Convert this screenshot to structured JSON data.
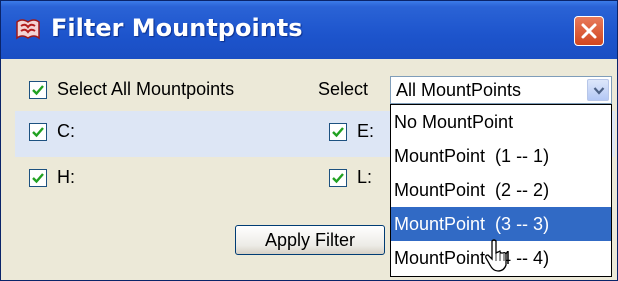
{
  "window": {
    "title": "Filter Mountpoints",
    "app_icon": "mountpoint-app-icon",
    "close_icon": "close-icon"
  },
  "filter": {
    "select_all_label": "Select All Mountpoints",
    "select_all_checked": true,
    "select_label": "Select",
    "select_value": "All MountPoints"
  },
  "drives": [
    {
      "label": "C:",
      "checked": true
    },
    {
      "label": "E:",
      "checked": true
    },
    {
      "label": "H:",
      "checked": true
    },
    {
      "label": "L:",
      "checked": true
    }
  ],
  "apply_button": "Apply Filter",
  "dropdown": {
    "items": [
      {
        "label": "No MountPoint"
      },
      {
        "label": "MountPoint  (1 -- 1)"
      },
      {
        "label": "MountPoint  (2 -- 2)"
      },
      {
        "label": "MountPoint  (3 -- 3)"
      },
      {
        "label": "MountPoint  (4 -- 4)"
      }
    ],
    "highlighted_index": 3
  },
  "colors": {
    "titlebar": "#1d54cc",
    "selection": "#316ac5",
    "check": "#21a121"
  }
}
